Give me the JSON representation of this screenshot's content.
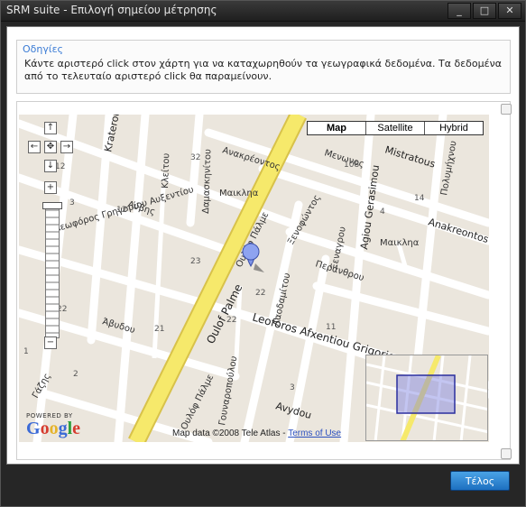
{
  "window": {
    "title": "SRM suite - Επιλογή σημείου μέτρησης",
    "controls": [
      "_",
      "□",
      "✕"
    ]
  },
  "instructions": {
    "title": "Οδηγίες",
    "line1": "Κάντε αριστερό click στον χάρτη για να καταχωρηθούν τα γεωγραφικά δεδομένα. Τα δεδομένα",
    "line2": "από το τελευταίο αριστερό click θα παραμείνουν."
  },
  "map": {
    "maptypes": [
      "Map",
      "Satellite",
      "Hybrid"
    ],
    "active_maptype": "Map",
    "powered_by": "POWERED BY",
    "google": "Google",
    "copyright": "Map data ©2008 Tele Atlas - ",
    "terms_link": "Terms of Use",
    "street_labels": {
      "oulof_palme": "Oulof Palme",
      "oulof_palme_gr": "Ουλόφ Πάλμε",
      "leoforos": "Leoforos Afxentiou Grigoriou",
      "agiou_gerasimou": "Agiou Gerasimou",
      "anakreontos": "Anakreontos",
      "anakreontos_gr": "Ανακρέοντος",
      "avydou": "Avydou",
      "avydou_gr": "Άβυδου",
      "leoforos_gr": "Λεωφόρος Γρηγορίου Αυξεντίου",
      "kraterou": "Kraterou",
      "mistratous": "Mistratous",
      "maiklia": "Μαικληα",
      "menonos": "Μενωνος",
      "polymichnou": "Πολυμήχνου",
      "peranthos": "Περάνθρου",
      "xenaros": "Ξεναγρου",
      "ladobitou": "Λαοδαμίτου",
      "xenofontos": "Ξενοφώντος",
      "lyvis": "Λύβης",
      "gazis": "Γάζης",
      "gounaropoulou": "Γουναροπούλου",
      "kleitou": "Κλείτου",
      "damoskenitou": "Δαμασκηνίτου"
    },
    "numbers": [
      "32",
      "108",
      "12",
      "23",
      "22",
      "14",
      "22",
      "4",
      "22",
      "1",
      "2",
      "11",
      "3",
      "21",
      "3",
      "12"
    ]
  },
  "footer": {
    "done_label": "Τέλος"
  },
  "colors": {
    "highway": "#f6e96b",
    "highway_edge": "#d8c24a",
    "street": "#ffffff",
    "block": "#ebe6dd",
    "accent": "#1d6fc0"
  }
}
